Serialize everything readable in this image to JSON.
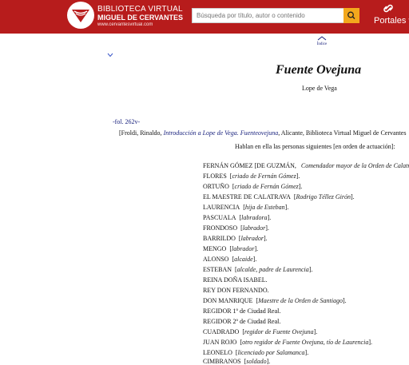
{
  "header": {
    "logo_line1": "BIBLIOTECA VIRTUAL",
    "logo_line2": "MIGUEL DE CERVANTES",
    "logo_line3": "www.cervantesvirtual.com",
    "search_placeholder": "Búsqueda por título, autor o contenido",
    "portales_label": "Portales"
  },
  "nav": {
    "indice_label": "Índice"
  },
  "work": {
    "title": "Fuente Ovejuna",
    "author": "Lope de Vega",
    "folio": "-fol. 262v-",
    "citation_before": "[Froldi, Rinaldo, ",
    "citation_link": "Introducción a Lope de Vega. Fuenteovejuna",
    "citation_after": ", Alicante, Biblioteca Virtual Miguel de Cervantes",
    "hablan": "Hablan en ella las personas siguientes [en orden de actuación]:"
  },
  "dramatis_personae": [
    {
      "name": "FERNÁN GÓMEZ [DE GUZMÁN,",
      "desc": "Comendador mayor de la Orden de Calatrava]",
      "close": ""
    },
    {
      "name": "FLORES",
      "desc": "criado de Fernán Gómez",
      "close": "]."
    },
    {
      "name": "ORTUÑO",
      "desc": "criado de Fernán Gómez",
      "close": "]."
    },
    {
      "name": "EL MAESTRE DE CALATRAVA",
      "desc": "Rodrigo Téllez Girón",
      "close": "]."
    },
    {
      "name": "LAURENCIA",
      "desc": "hija de Esteban",
      "close": "]."
    },
    {
      "name": "PASCUALA",
      "desc": "labradora",
      "close": "]."
    },
    {
      "name": "FRONDOSO",
      "desc": "labrador",
      "close": "]."
    },
    {
      "name": "BARRILDO",
      "desc": "labrador",
      "close": "]."
    },
    {
      "name": "MENGO",
      "desc": "labrador",
      "close": "]."
    },
    {
      "name": "ALONSO",
      "desc": "alcaide",
      "close": "]."
    },
    {
      "name": "ESTEBAN",
      "desc": "alcalde, padre de Laurencia",
      "close": "]."
    },
    {
      "name": "REINA DOÑA ISABEL.",
      "desc": "",
      "close": ""
    },
    {
      "name": "REY DON FERNANDO.",
      "desc": "",
      "close": ""
    },
    {
      "name": "DON MANRIQUE",
      "desc": "Maestre de la Orden de Santiago",
      "close": "]."
    },
    {
      "name": "REGIDOR 1º de Ciudad Real.",
      "desc": "",
      "close": ""
    },
    {
      "name": "REGIDOR 2º de Ciudad Real.",
      "desc": "",
      "close": ""
    },
    {
      "name": "CUADRADO",
      "desc": "regidor de Fuente Ovejuna",
      "close": "]."
    },
    {
      "name": "JUAN ROJO",
      "desc": "otro regidor de Fuente Ovejuna, tío de Laurencia",
      "close": "]."
    },
    {
      "name": "LEONELO",
      "desc": "licenciado por Salamanca",
      "close": "]."
    },
    {
      "name": "CIMBRANOS",
      "desc": "soldado",
      "close": "]."
    }
  ]
}
